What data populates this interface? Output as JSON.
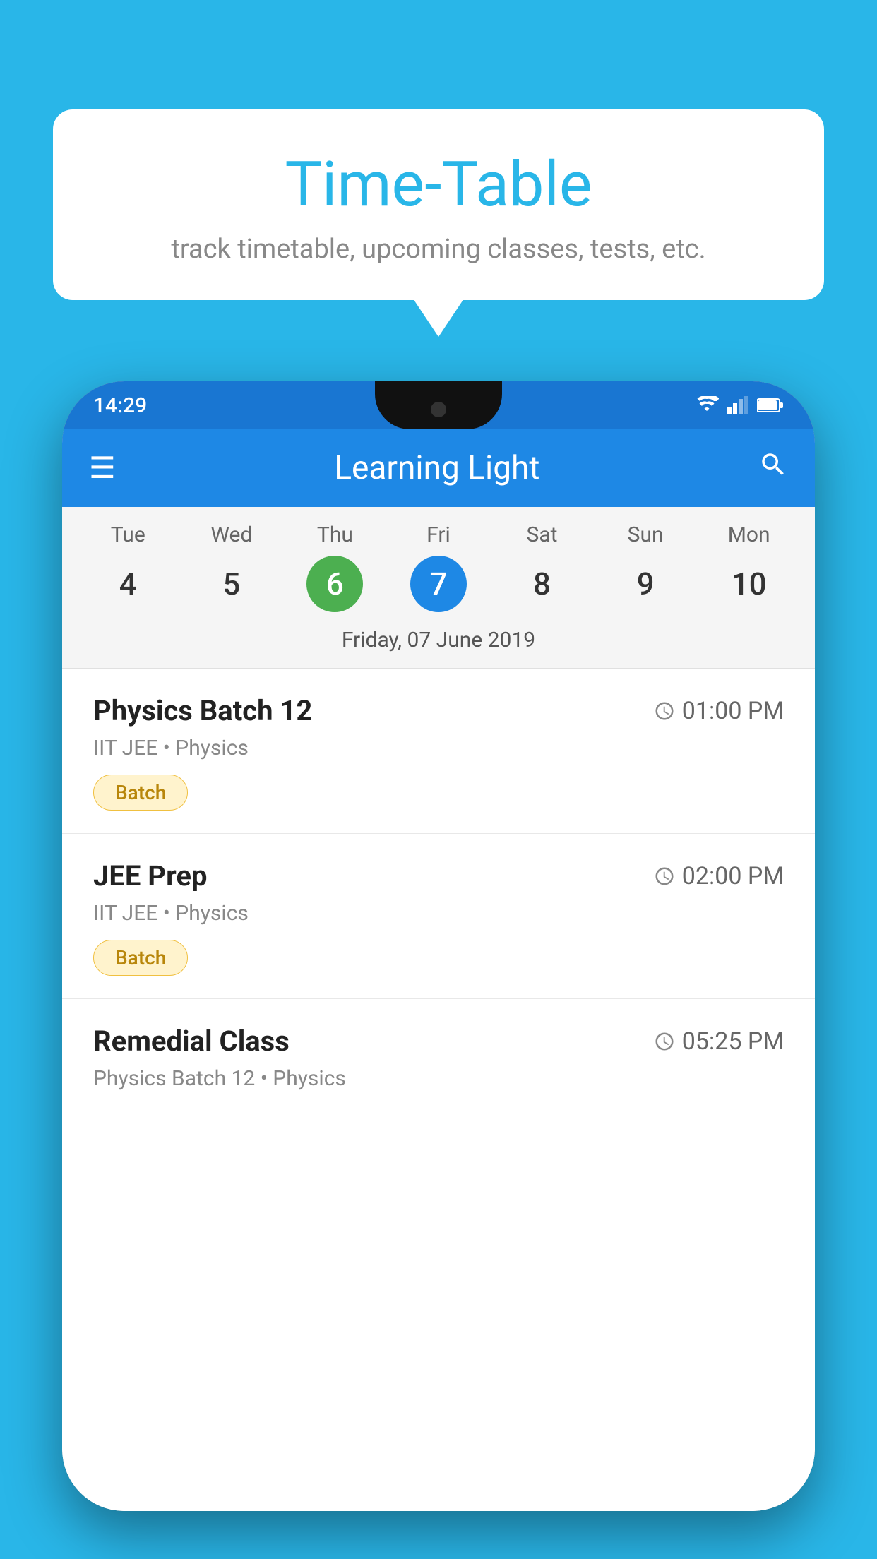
{
  "background_color": "#29B6E8",
  "speech_bubble": {
    "title": "Time-Table",
    "subtitle": "track timetable, upcoming classes, tests, etc."
  },
  "phone": {
    "status_bar": {
      "time": "14:29"
    },
    "app_bar": {
      "title": "Learning Light"
    },
    "calendar": {
      "days": [
        {
          "label": "Tue",
          "number": "4",
          "state": "normal"
        },
        {
          "label": "Wed",
          "number": "5",
          "state": "normal"
        },
        {
          "label": "Thu",
          "number": "6",
          "state": "today"
        },
        {
          "label": "Fri",
          "number": "7",
          "state": "selected"
        },
        {
          "label": "Sat",
          "number": "8",
          "state": "normal"
        },
        {
          "label": "Sun",
          "number": "9",
          "state": "normal"
        },
        {
          "label": "Mon",
          "number": "10",
          "state": "normal"
        }
      ],
      "selected_date_label": "Friday, 07 June 2019"
    },
    "schedule": [
      {
        "title": "Physics Batch 12",
        "time": "01:00 PM",
        "subtitle": "IIT JEE • Physics",
        "badge": "Batch"
      },
      {
        "title": "JEE Prep",
        "time": "02:00 PM",
        "subtitle": "IIT JEE • Physics",
        "badge": "Batch"
      },
      {
        "title": "Remedial Class",
        "time": "05:25 PM",
        "subtitle": "Physics Batch 12 • Physics",
        "badge": null
      }
    ]
  }
}
